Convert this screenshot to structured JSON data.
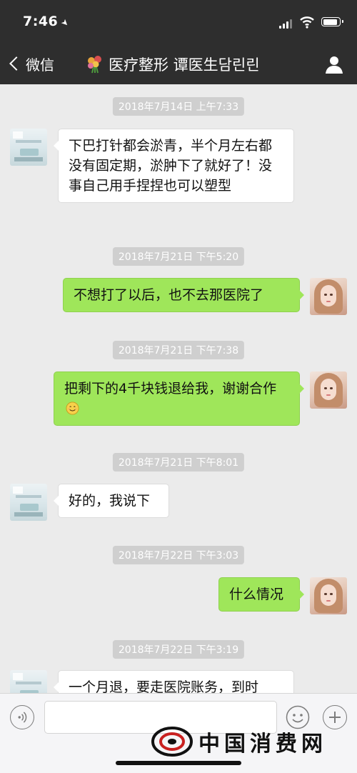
{
  "status_bar": {
    "time": "7:46"
  },
  "nav": {
    "back_label": "微信",
    "title": "医疗整形 谭医生담린린"
  },
  "messages": [
    {
      "timestamp": "2018年7月14日 上午7:33",
      "side": "left",
      "text": "下巴打针都会淤青，半个月左右都没有固定期，淤肿下了就好了！没事自己用手捏捏也可以塑型"
    },
    {
      "timestamp": "2018年7月21日 下午5:20",
      "side": "right",
      "text": "不想打了以后，也不去那医院了"
    },
    {
      "timestamp": "2018年7月21日 下午7:38",
      "side": "right",
      "text": "把剩下的4千块钱退给我，谢谢合作",
      "emoji": "smile-emoji"
    },
    {
      "timestamp": "2018年7月21日 下午8:01",
      "side": "left",
      "text": "好的，我说下"
    },
    {
      "timestamp": "2018年7月22日 下午3:03",
      "side": "right",
      "text": "什么情况"
    },
    {
      "timestamp": "2018年7月22日 下午3:19",
      "side": "left",
      "text": "一个月退，要走医院账务，到时"
    }
  ],
  "input": {
    "value": "",
    "placeholder": ""
  },
  "watermark": {
    "text": "中国消费网"
  },
  "colors": {
    "nav_bg": "#2e2e2e",
    "chat_bg": "#ebebeb",
    "bubble_right": "#9fe65a",
    "bubble_left": "#ffffff",
    "timestamp_bg": "#cfcfcf"
  }
}
